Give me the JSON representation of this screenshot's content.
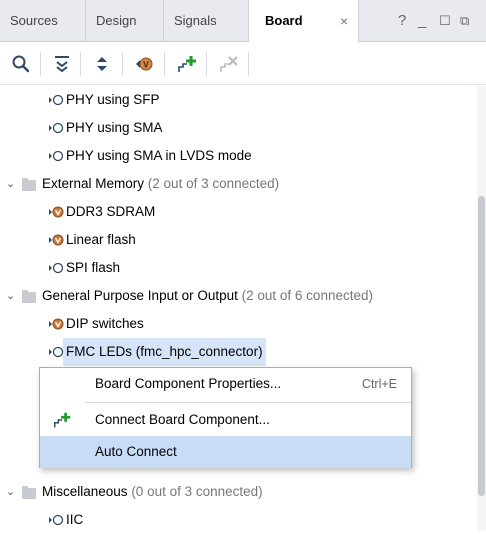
{
  "tabs": [
    {
      "label": "Sources"
    },
    {
      "label": "Design"
    },
    {
      "label": "Signals"
    },
    {
      "label": "Board",
      "active": true
    }
  ],
  "tab_close": "×",
  "window_controls": {
    "help": "?",
    "minimize": "_",
    "maximize": "☐",
    "restore": "⧉"
  },
  "toolbar": {
    "icons": [
      "search-icon",
      "collapse-all-icon",
      "expand-all-icon",
      "board-part-icon",
      "connect-board-component-icon",
      "disconnect-board-component-icon"
    ]
  },
  "tree": {
    "items": [
      {
        "label": "PHY using SFP",
        "status": "unconnected"
      },
      {
        "label": "PHY using SMA",
        "status": "unconnected"
      },
      {
        "label": "PHY using SMA in LVDS mode",
        "status": "unconnected"
      },
      {
        "label": "External Memory",
        "detail": "(2 out of 3 connected)"
      },
      {
        "label": "DDR3 SDRAM",
        "status": "connected"
      },
      {
        "label": "Linear flash",
        "status": "connected"
      },
      {
        "label": "SPI flash",
        "status": "unconnected"
      },
      {
        "label": "General Purpose Input or Output",
        "detail": "(2 out of 6 connected)"
      },
      {
        "label": "DIP switches",
        "status": "connected"
      },
      {
        "label": "FMC LEDs (fmc_hpc_connector)",
        "status": "unconnected",
        "selected": true
      },
      {
        "label": "Miscellaneous",
        "detail": "(0 out of 3 connected)"
      },
      {
        "label": "IIC",
        "status": "unconnected"
      }
    ]
  },
  "context_menu": {
    "items": [
      {
        "label": "Board Component Properties...",
        "shortcut": "Ctrl+E"
      },
      {
        "label": "Connect Board Component..."
      },
      {
        "label": "Auto Connect",
        "highlighted": true
      }
    ]
  },
  "colors": {
    "tab_bar": "#e8eaf0",
    "selection": "#d6e4f8",
    "menu_highlight": "#c9dcf5",
    "connected_icon": "#b5652a",
    "add_icon": "#1e9e2e"
  }
}
